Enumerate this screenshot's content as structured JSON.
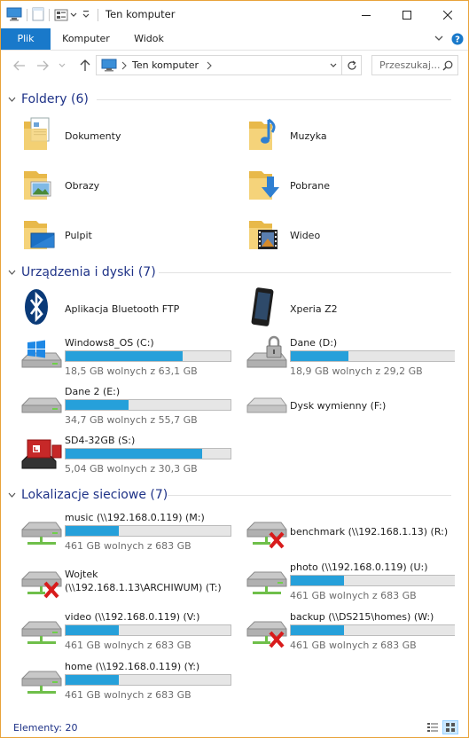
{
  "window": {
    "title": "Ten komputer",
    "colors": {
      "accent": "#1979ca",
      "frame": "#e8a33a",
      "group_title": "#1e3287",
      "bar_fill": "#26a0da"
    }
  },
  "ribbon": {
    "tabs": [
      {
        "label": "Plik"
      },
      {
        "label": "Komputer"
      },
      {
        "label": "Widok"
      }
    ]
  },
  "address": {
    "path": "Ten komputer",
    "search_placeholder": "Przeszukaj..."
  },
  "groups": [
    {
      "title": "Foldery (6)",
      "items": [
        {
          "name": "Dokumenty",
          "icon": "folder-documents-icon"
        },
        {
          "name": "Muzyka",
          "icon": "folder-music-icon"
        },
        {
          "name": "Obrazy",
          "icon": "folder-pictures-icon"
        },
        {
          "name": "Pobrane",
          "icon": "folder-downloads-icon"
        },
        {
          "name": "Pulpit",
          "icon": "folder-desktop-icon"
        },
        {
          "name": "Wideo",
          "icon": "folder-video-icon"
        }
      ]
    },
    {
      "title": "Urządzenia i dyski (7)",
      "items": [
        {
          "name": "Aplikacja Bluetooth FTP",
          "icon": "bluetooth-icon"
        },
        {
          "name": "Xperia Z2",
          "icon": "phone-icon"
        },
        {
          "name": "Windows8_OS (C:)",
          "icon": "windows-drive-icon",
          "free": "18,5 GB wolnych z 63,1 GB",
          "used_fraction": 0.71
        },
        {
          "name": "Dane (D:)",
          "icon": "locked-drive-icon",
          "free": "18,9 GB wolnych z 29,2 GB",
          "used_fraction": 0.35
        },
        {
          "name": "Dane 2 (E:)",
          "icon": "drive-icon",
          "free": "34,7 GB wolnych z 55,7 GB",
          "used_fraction": 0.38
        },
        {
          "name": "Dysk wymienny (F:)",
          "icon": "removable-drive-icon"
        },
        {
          "name": "SD4-32GB (S:)",
          "icon": "sd-card-icon",
          "free": "5,04 GB wolnych z 30,3 GB",
          "used_fraction": 0.83
        }
      ]
    },
    {
      "title": "Lokalizacje sieciowe (7)",
      "items": [
        {
          "name": "music (\\\\192.168.0.119) (M:)",
          "icon": "network-drive-icon",
          "free": "461 GB wolnych z 683 GB",
          "used_fraction": 0.32
        },
        {
          "name": "benchmark (\\\\192.168.1.13) (R:)",
          "icon": "network-drive-disconnected-icon"
        },
        {
          "name": "Wojtek",
          "name2": "(\\\\192.168.1.13\\ARCHIWUM) (T:)",
          "icon": "network-drive-disconnected-icon"
        },
        {
          "name": "photo (\\\\192.168.0.119) (U:)",
          "icon": "network-drive-icon",
          "free": "461 GB wolnych z 683 GB",
          "used_fraction": 0.32
        },
        {
          "name": "video (\\\\192.168.0.119) (V:)",
          "icon": "network-drive-icon",
          "free": "461 GB wolnych z 683 GB",
          "used_fraction": 0.32
        },
        {
          "name": "backup (\\\\DS215\\homes) (W:)",
          "icon": "network-drive-icon",
          "free": "461 GB wolnych z 683 GB",
          "used_fraction": 0.32
        },
        {
          "name": "home (\\\\192.168.0.119) (Y:)",
          "icon": "network-drive-icon",
          "free": "461 GB wolnych z 683 GB",
          "used_fraction": 0.32
        }
      ]
    }
  ],
  "status": {
    "count": "Elementy: 20"
  }
}
